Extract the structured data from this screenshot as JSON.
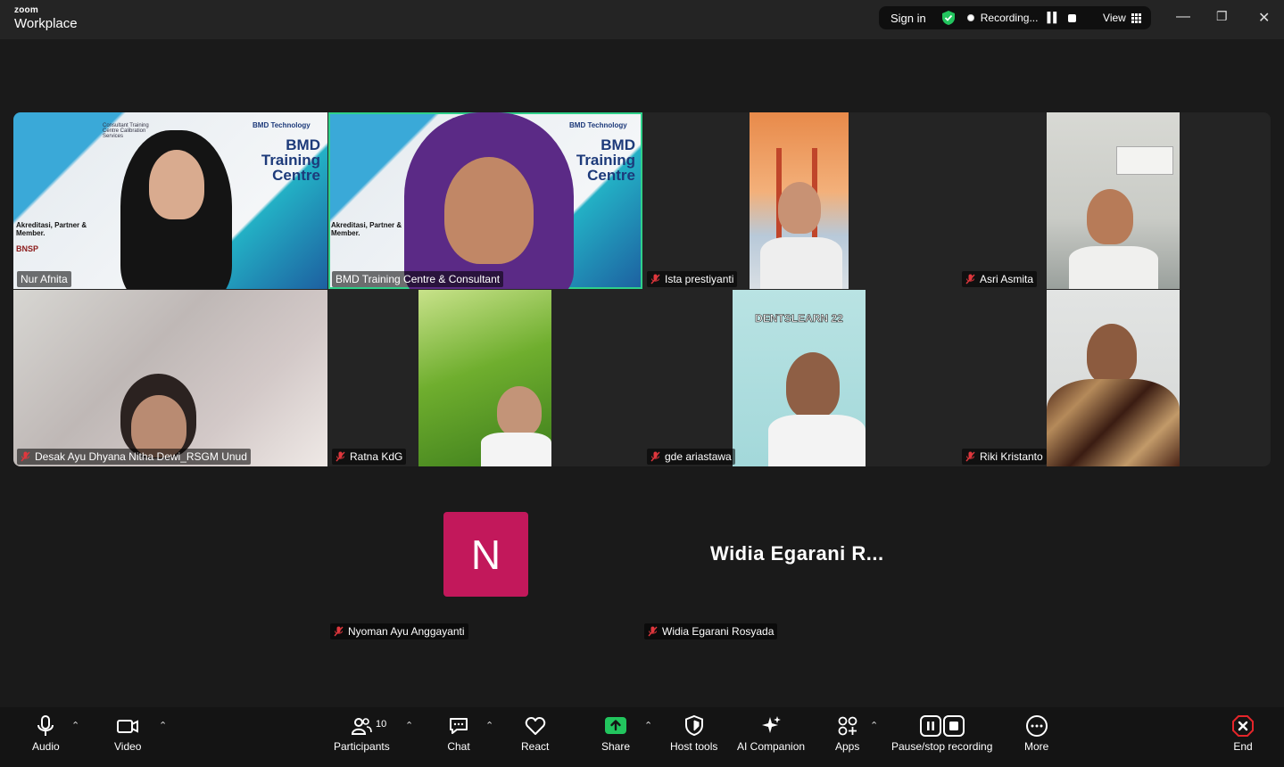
{
  "titlebar": {
    "brand_top": "zoom",
    "brand_main": "Workplace",
    "sign_in": "Sign in",
    "recording": "Recording...",
    "view": "View"
  },
  "participants": [
    {
      "name": "Nur Afnita"
    },
    {
      "name": "BMD Training Centre & Consultant"
    },
    {
      "name": "Ista prestiyanti"
    },
    {
      "name": "Asri Asmita"
    },
    {
      "name": "Desak Ayu Dhyana Nitha Dewi_RSGM Unud"
    },
    {
      "name": "Ratna KdG"
    },
    {
      "name": "gde ariastawa"
    },
    {
      "name": "Riki Kristanto"
    },
    {
      "name": "Nyoman Ayu Anggayanti",
      "initial": "N"
    },
    {
      "name": "Widia Egarani Rosyada",
      "display": "Widia Egarani R..."
    }
  ],
  "background_text": {
    "bmd_title_1": "BMD",
    "bmd_title_2": "Training",
    "bmd_title_3": "Centre",
    "bmd_accred": "Akreditasi, Partner & Member.",
    "bmd_bnsp": "BNSP",
    "bmd_tech": "BMD Technology",
    "bmd_consult": "Consultant Training Centre Calibration Services",
    "dentslearn": "DENTSLEARN 22"
  },
  "toolbar": {
    "audio": "Audio",
    "video": "Video",
    "participants": "Participants",
    "participants_count": "10",
    "chat": "Chat",
    "react": "React",
    "share": "Share",
    "host_tools": "Host tools",
    "ai_companion": "AI Companion",
    "apps": "Apps",
    "pause_stop": "Pause/stop recording",
    "more": "More",
    "end": "End"
  },
  "colors": {
    "active_speaker": "#2ed08a",
    "share_green": "#22c55e",
    "end_red": "#e5252a",
    "avatar": "#c2185b",
    "mute_red": "#e0373d"
  }
}
